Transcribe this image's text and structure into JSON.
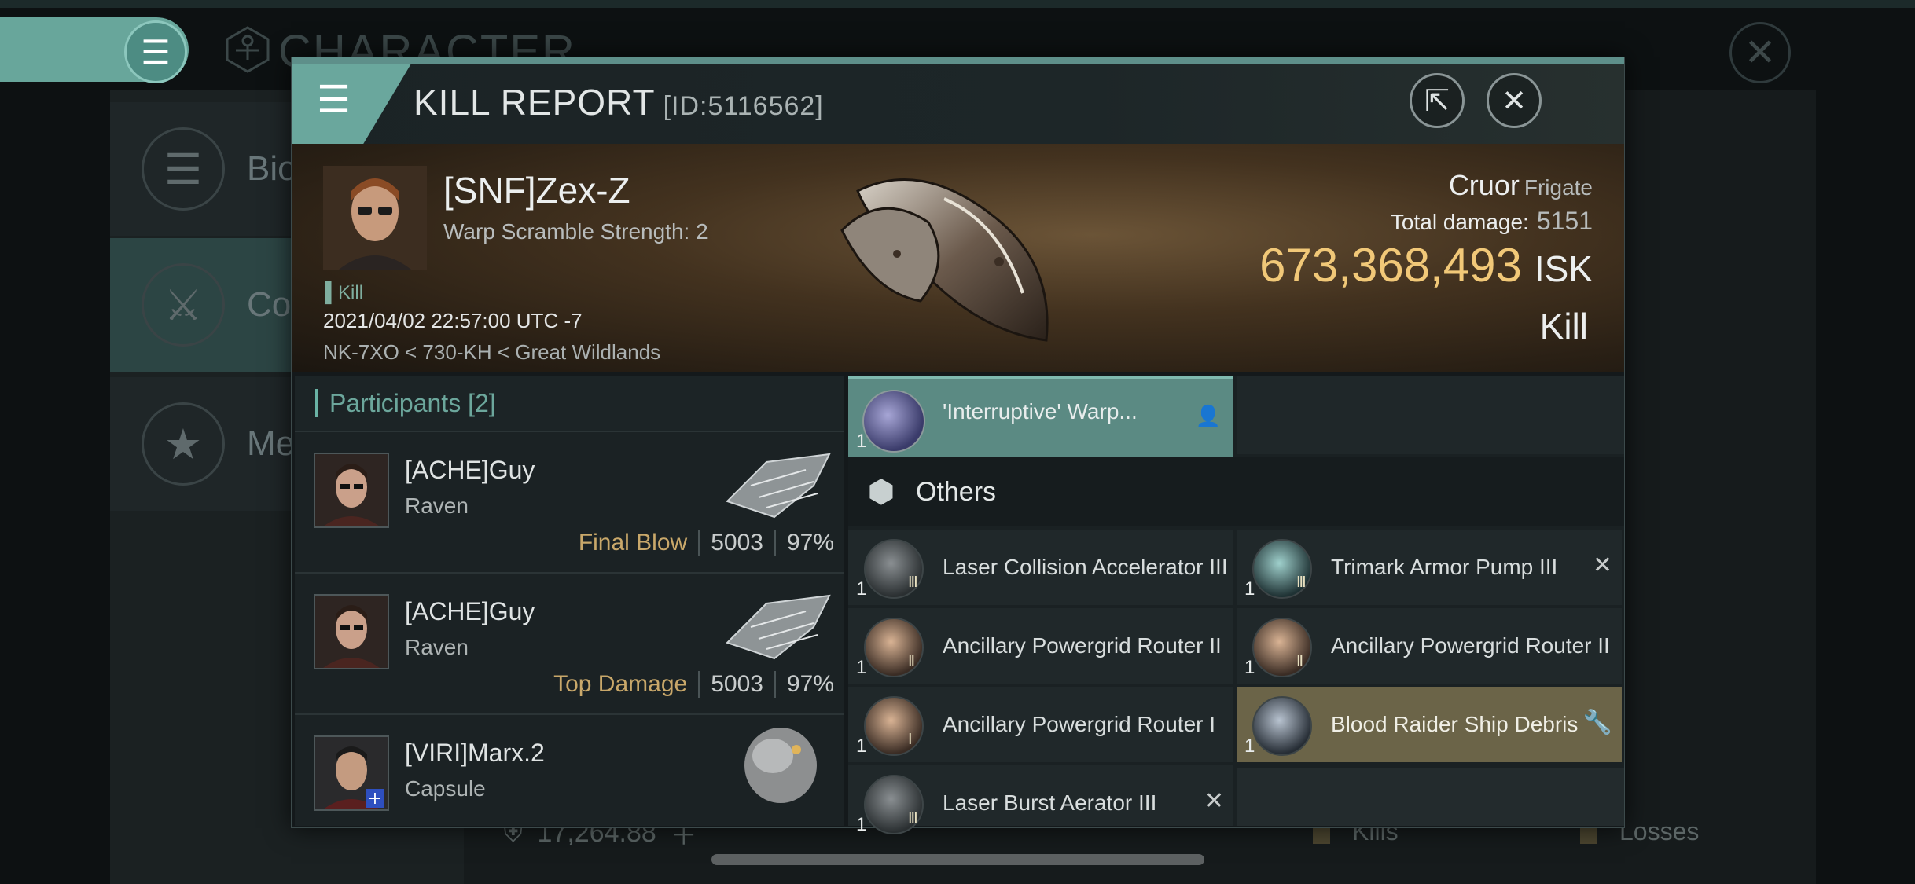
{
  "background": {
    "screen_title": "CHARACTER",
    "sidebar": [
      {
        "label": "Bio",
        "icon": "menu-lines-icon"
      },
      {
        "label": "Con",
        "icon": "crossed-swords-icon"
      },
      {
        "label": "Med",
        "icon": "star-icon"
      }
    ],
    "isk_value": "17,264.88",
    "kills_label": "Kills",
    "losses_label": "Losses"
  },
  "header": {
    "title": "KILL REPORT",
    "id": "[ID:5116562]"
  },
  "victim": {
    "name": "[SNF]Zex-Z",
    "subtitle": "Warp Scramble Strength: 2",
    "kill_tag": "Kill",
    "datetime": "2021/04/02 22:57:00 UTC -7",
    "location": "NK-7XO < 730-KH < Great Wildlands",
    "ship": "Cruor",
    "ship_class": "Frigate",
    "total_damage_label": "Total damage:",
    "total_damage": "5151",
    "isk_value": "673,368,493",
    "isk_unit": "ISK",
    "report_type": "Kill"
  },
  "participants": {
    "title": "Participants",
    "count": "[2]",
    "rows": [
      {
        "name": "[ACHE]Guy",
        "ship": "Raven",
        "tag": "Final Blow",
        "damage": "5003",
        "percent": "97%"
      },
      {
        "name": "[ACHE]Guy",
        "ship": "Raven",
        "tag": "Top Damage",
        "damage": "5003",
        "percent": "97%"
      },
      {
        "name": "[VIRI]Marx.2",
        "ship": "Capsule",
        "tag": "",
        "damage": "",
        "percent": ""
      }
    ]
  },
  "items": {
    "fitted": {
      "name": "'Interruptive' Warp...",
      "qty": "1"
    },
    "others_label": "Others",
    "list": [
      {
        "name": "Laser Collision Accelerator III",
        "qty": "1",
        "meta": "III",
        "mark": "›",
        "state": "normal",
        "icon": "laser-icon"
      },
      {
        "name": "Trimark Armor Pump III",
        "qty": "1",
        "meta": "III",
        "mark": "✕",
        "state": "destroyed",
        "icon": "armor-icon"
      },
      {
        "name": "Ancillary Powergrid Router II",
        "qty": "1",
        "meta": "II",
        "mark": "›",
        "state": "normal",
        "icon": "powergrid-icon"
      },
      {
        "name": "Ancillary Powergrid Router II",
        "qty": "1",
        "meta": "II",
        "mark": "",
        "state": "normal",
        "icon": "powergrid-icon"
      },
      {
        "name": "Ancillary Powergrid Router I",
        "qty": "1",
        "meta": "I",
        "mark": "›",
        "state": "normal",
        "icon": "powergrid-icon"
      },
      {
        "name": "Blood Raider Ship Debris",
        "qty": "1",
        "meta": "",
        "mark": "🔧",
        "state": "dropped",
        "icon": "debris-icon"
      },
      {
        "name": "Laser Burst Aerator III",
        "qty": "1",
        "meta": "III",
        "mark": "✕",
        "state": "destroyed",
        "icon": "laser-icon"
      }
    ]
  },
  "colors": {
    "accent": "#6aa79d",
    "isk": "#f1c878",
    "highlight": "#6b6448"
  }
}
